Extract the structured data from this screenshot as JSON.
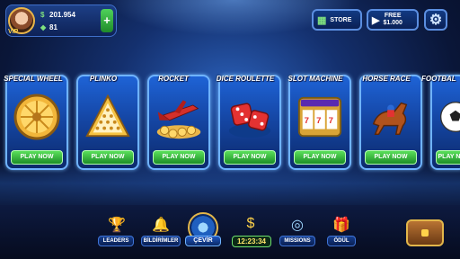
{
  "header": {
    "coins": "201.954",
    "gems": "81",
    "vip": "VIP",
    "plus_label": "+",
    "store_label": "STORE",
    "free_line1": "FREE",
    "free_line2": "$1.000",
    "settings_icon": "gear-icon"
  },
  "games": [
    {
      "title": "SPECIAL WHEEL",
      "play": "PLAY NOW",
      "icon": "wheel-icon"
    },
    {
      "title": "PLINKO",
      "play": "PLAY NOW",
      "icon": "plinko-icon"
    },
    {
      "title": "ROCKET",
      "play": "PLAY NOW",
      "icon": "rocket-icon"
    },
    {
      "title": "DICE ROULETTE",
      "play": "PLAY NOW",
      "icon": "dice-icon"
    },
    {
      "title": "SLOT MACHINE",
      "play": "PLAY NOW",
      "icon": "slot-icon"
    },
    {
      "title": "HORSE RACE",
      "play": "PLAY NOW",
      "icon": "horse-icon"
    },
    {
      "title": "FOOTBAL",
      "play": "PLAY NOW",
      "icon": "football-icon"
    }
  ],
  "bottom": {
    "leaders": "LEADERS",
    "notifications": "BİLDİRİMLER",
    "spin": "ÇEVİR",
    "timer": "12:23:34",
    "missions": "MISSIONS",
    "reward": "ÖDÜL"
  },
  "colors": {
    "accent": "#6fb3ff",
    "play_green": "#1c8e27",
    "gold": "#e2b64a"
  }
}
